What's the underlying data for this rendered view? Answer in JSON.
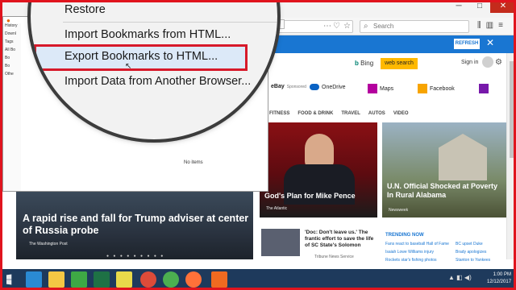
{
  "browser": {
    "search_placeholder": "Search",
    "window_controls": {
      "min": "─",
      "max": "□",
      "close": "✕"
    }
  },
  "msn": {
    "refresh_label": "REFRESH",
    "close_label": "✕",
    "bing_label": "Bing",
    "web_search_label": "web search",
    "signin_label": "Sign in",
    "services": [
      {
        "label": "eBay",
        "sub": "Sponsored",
        "color": "#e53238"
      },
      {
        "label": "OneDrive",
        "color": "#0a63c4"
      },
      {
        "label": "Maps",
        "color": "#b4009e"
      },
      {
        "label": "Facebook",
        "color": "#f7a400"
      }
    ],
    "categories": [
      "FITNESS",
      "FOOD & DRINK",
      "TRAVEL",
      "AUTOS",
      "VIDEO"
    ],
    "tiles": {
      "pence": {
        "title": "God's Plan for Mike Pence",
        "source": "The Atlantic"
      },
      "alabama": {
        "title": "U.N. Official Shocked at Poverty In Rural Alabama",
        "source": "Newsweek"
      },
      "main": {
        "title": "A rapid rise and fall for Trump adviser at center of Russia probe",
        "source": "The Washington Post"
      }
    },
    "news_item": {
      "title": "'Doc: Don't leave us.' The frantic effort to save the life of SC State's Solomon",
      "source": "Tribune News Service"
    },
    "trending": {
      "header": "TRENDING NOW",
      "items": [
        "Fans react to baseball Hall of Fame",
        "BC upset Duke",
        "Isaiah Lowe Williams injury",
        "Brady apologizes",
        "Rockets star's fishing photos",
        "Stanton to Yankees"
      ]
    }
  },
  "library": {
    "tree_items": [
      "History",
      "Downl",
      "Tags",
      "All Bo",
      "Bo",
      "Bo",
      "Othe"
    ],
    "no_items_label": "No items",
    "menu": {
      "restore_label": "Restore",
      "import_html_label": "Import Bookmarks from HTML...",
      "export_html_label": "Export Bookmarks to HTML...",
      "import_other_label": "Import Data from Another Browser..."
    }
  },
  "taskbar": {
    "time": "1:00 PM",
    "date": "12/12/2017",
    "icons": [
      {
        "name": "ie",
        "color": "#2a8ad4"
      },
      {
        "name": "explorer",
        "color": "#f3c744"
      },
      {
        "name": "media",
        "color": "#3ea845"
      },
      {
        "name": "excel",
        "color": "#1e7145"
      },
      {
        "name": "sticky",
        "color": "#e8d94a"
      },
      {
        "name": "chrome",
        "color": "#dd4b39"
      },
      {
        "name": "chrome2",
        "color": "#4caf50"
      },
      {
        "name": "firefox",
        "color": "#ff7139"
      },
      {
        "name": "app",
        "color": "#f06a20"
      }
    ]
  }
}
